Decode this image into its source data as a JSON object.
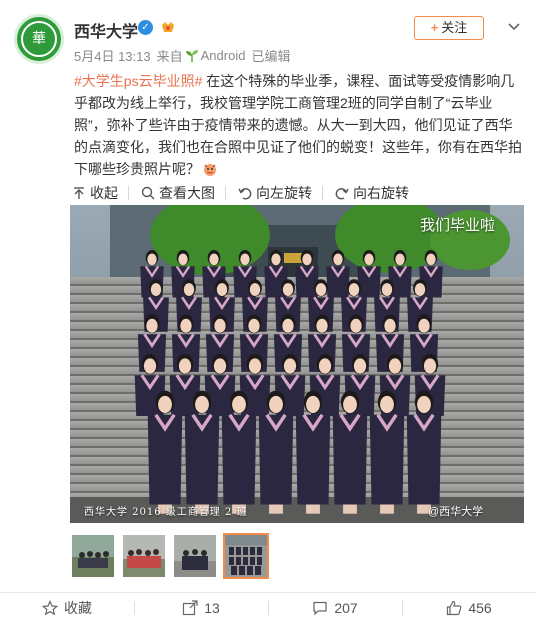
{
  "account": {
    "name": "西华大学",
    "avatar_text": "華",
    "verified_icon": "✓",
    "date": "5月4日 13:13",
    "source_prefix": "来自",
    "source": "Android",
    "edited": "已编辑"
  },
  "follow": {
    "plus": "+",
    "label": "关注"
  },
  "post": {
    "tag": "#大学生ps云毕业照#",
    "body": " 在这个特殊的毕业季，课程、面试等受疫情影响几乎都改为线上举行，我校管理学院工商管理2班的同学自制了“云毕业照”，弥补了些许由于疫情带来的遗憾。从大一到大四，他们见证了西华的点滴变化，我们也在合照中见证了他们的蜕变！这些年，你有在西华拍下哪些珍贵照片呢？"
  },
  "toolbar": {
    "collapse": "收起",
    "view_large": "查看大图",
    "rotate_left": "向左旋转",
    "rotate_right": "向右旋转"
  },
  "photo": {
    "overlay_title": "我们毕业啦",
    "caption": "西华大学 2016 级工商管理 2 班",
    "watermark": "@西华大学"
  },
  "thumbnails": [
    {
      "label": "thumb-1",
      "active": false
    },
    {
      "label": "thumb-2",
      "active": false
    },
    {
      "label": "thumb-3",
      "active": false
    },
    {
      "label": "thumb-4",
      "active": true
    }
  ],
  "footer": {
    "favorite": "收藏",
    "repost_count": "13",
    "comment_count": "207",
    "like_count": "456"
  },
  "colors": {
    "accent": "#f28c48",
    "tag": "#eb7350",
    "brand_green": "#2f9a3a",
    "verified_blue": "#2d8de0"
  },
  "icons": {
    "collapse": "arrow-up-icon",
    "view_large": "search-icon",
    "rotate_left": "rotate-left-icon",
    "rotate_right": "rotate-right-icon",
    "favorite": "star-icon",
    "repost": "share-icon",
    "comment": "comment-icon",
    "like": "thumbs-up-icon",
    "more": "chevron-down-icon"
  }
}
